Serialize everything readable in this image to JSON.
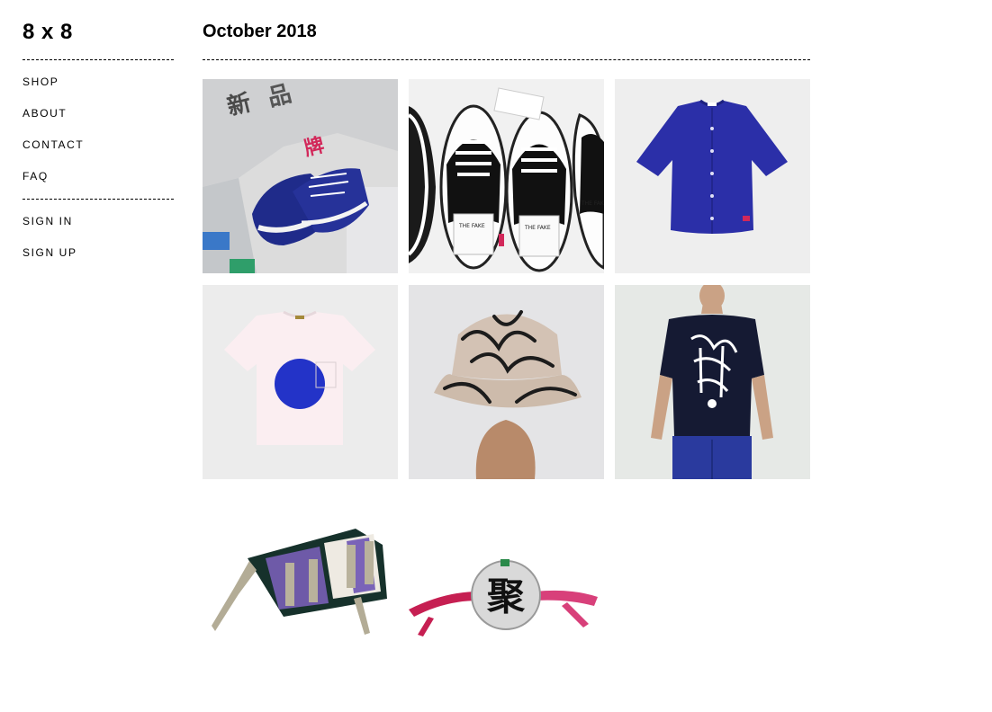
{
  "site": {
    "logo": "8 x 8"
  },
  "nav": {
    "primary": [
      "SHOP",
      "ABOUT",
      "CONTACT",
      "FAQ"
    ],
    "account": [
      "SIGN IN",
      "SIGN UP"
    ]
  },
  "main": {
    "title": "October 2018"
  },
  "products": {
    "1": {
      "glyphs": [
        "新",
        "品",
        "牌"
      ]
    },
    "2": {
      "insole_label": "THE FAKE"
    },
    "7": {
      "glyph": "聚"
    }
  },
  "colors": {
    "text": "#000000",
    "tile_bg": "#ececec",
    "cobalt": "#2b2fa8",
    "pink": "#d2285a"
  }
}
